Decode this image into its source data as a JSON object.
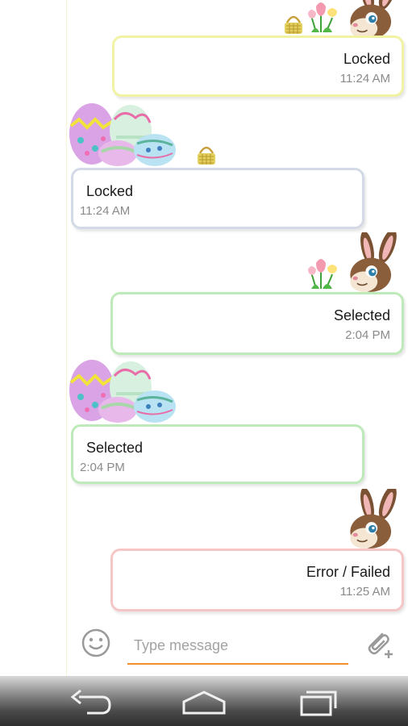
{
  "messages": [
    {
      "direction": "outgoing",
      "status": "Locked",
      "time": "11:24 AM",
      "border": "#f2f2a4",
      "decoration": [
        "bunny-avatar",
        "tulip-flowers",
        "basket-icon"
      ]
    },
    {
      "direction": "incoming",
      "status": "Locked",
      "time": "11:24 AM",
      "border": "#d3dae6",
      "decoration": [
        "easter-eggs",
        "basket-icon"
      ]
    },
    {
      "direction": "outgoing",
      "status": "Selected",
      "time": "2:04 PM",
      "border": "#bdeab8",
      "decoration": [
        "bunny-avatar",
        "tulip-flowers"
      ]
    },
    {
      "direction": "incoming",
      "status": "Selected",
      "time": "2:04 PM",
      "border": "#bdeab8",
      "decoration": [
        "easter-eggs"
      ]
    },
    {
      "direction": "outgoing",
      "status": "Error / Failed",
      "time": "11:25 AM",
      "border": "#f4c6c6",
      "decoration": [
        "bunny-avatar"
      ]
    }
  ],
  "composer": {
    "placeholder": "Type message",
    "underline_color": "#f0902e",
    "emoji_icon": "smiley-icon",
    "attach_icon": "paperclip-add-icon"
  },
  "navbar": {
    "icons": [
      "back-icon",
      "home-icon",
      "recent-apps-icon"
    ]
  }
}
